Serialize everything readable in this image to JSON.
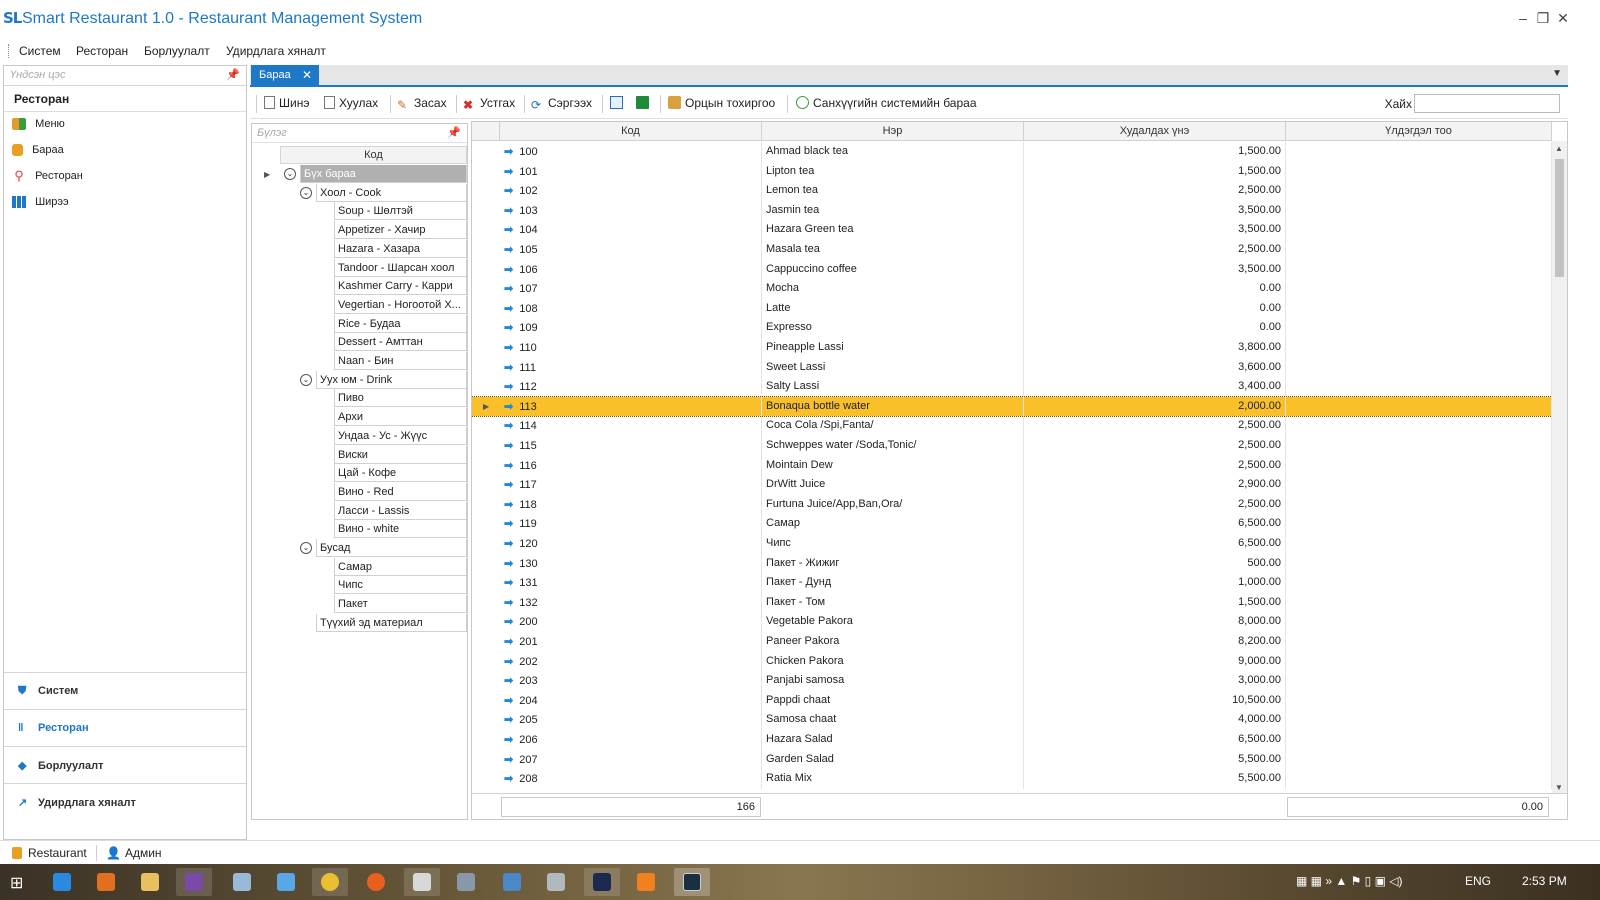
{
  "app": {
    "logo": "SL",
    "title": "Smart Restaurant 1.0 - Restaurant Management System"
  },
  "menu": [
    "Систем",
    "Ресторан",
    "Борлуулалт",
    "Удирдлага хяналт"
  ],
  "left_panel": {
    "header_placeholder": "Үндсэн цэс",
    "section_title": "Ресторан",
    "items": [
      {
        "label": "Меню",
        "icon": "menu-grid-icon"
      },
      {
        "label": "Бараа",
        "icon": "product-icon"
      },
      {
        "label": "Ресторан",
        "icon": "location-pin-icon"
      },
      {
        "label": "Ширээ",
        "icon": "table-grid-icon"
      }
    ],
    "nav": [
      {
        "label": "Систем",
        "icon": "shield-icon",
        "active": false
      },
      {
        "label": "Ресторан",
        "icon": "fork-knife-icon",
        "active": true
      },
      {
        "label": "Борлуулалт",
        "icon": "tag-icon",
        "active": false
      },
      {
        "label": "Удирдлага хяналт",
        "icon": "chart-icon",
        "active": false
      }
    ]
  },
  "tab": {
    "label": "Бараа"
  },
  "toolbar": {
    "new": "Шинэ",
    "copy": "Хуулах",
    "edit": "Засах",
    "delete": "Устгах",
    "refresh": "Сэргээх",
    "settings": "Орцын тохиргоо",
    "finance": "Санхүүгийн системийн бараа",
    "search_label": "Хайх"
  },
  "group_panel": {
    "header_placeholder": "Бүлэг",
    "column": "Код",
    "tree": [
      {
        "label": "Бүх бараа",
        "level": 0,
        "expander": true,
        "selected": true
      },
      {
        "label": "Хоол - Cook",
        "level": 1,
        "expander": true
      },
      {
        "label": "Soup - Шөлтэй",
        "level": 2
      },
      {
        "label": "Appetizer - Хачир",
        "level": 2
      },
      {
        "label": "Hazara - Хазара",
        "level": 2
      },
      {
        "label": "Tandoor - Шарсан хоол",
        "level": 2
      },
      {
        "label": "Kashmer Carry - Карри",
        "level": 2
      },
      {
        "label": "Vegertian - Ногоотой Х...",
        "level": 2
      },
      {
        "label": "Rice - Будаа",
        "level": 2
      },
      {
        "label": "Dessert - Амттан",
        "level": 2
      },
      {
        "label": "Naan - Бин",
        "level": 2
      },
      {
        "label": "Уух юм - Drink",
        "level": 1,
        "expander": true
      },
      {
        "label": "Пиво",
        "level": 2
      },
      {
        "label": "Архи",
        "level": 2
      },
      {
        "label": "Ундаа - Ус - Жүүс",
        "level": 2
      },
      {
        "label": "Виски",
        "level": 2
      },
      {
        "label": "Цай - Кофе",
        "level": 2
      },
      {
        "label": "Вино - Red",
        "level": 2
      },
      {
        "label": "Ласси - Lassis",
        "level": 2
      },
      {
        "label": "Вино - white",
        "level": 2
      },
      {
        "label": "Бусад",
        "level": 1,
        "expander": true
      },
      {
        "label": "Самар",
        "level": 2
      },
      {
        "label": "Чипс",
        "level": 2
      },
      {
        "label": "Пакет",
        "level": 2
      },
      {
        "label": "Түүхий эд материал",
        "level": 1
      }
    ]
  },
  "grid": {
    "columns": [
      "Код",
      "Нэр",
      "Худалдах үнэ",
      "Үлдэгдэл тоо"
    ],
    "selected_code": "113",
    "rows": [
      {
        "code": "100",
        "name": "Ahmad black tea",
        "price": "1,500.00"
      },
      {
        "code": "101",
        "name": "Lipton tea",
        "price": "1,500.00"
      },
      {
        "code": "102",
        "name": "Lemon tea",
        "price": "2,500.00"
      },
      {
        "code": "103",
        "name": "Jasmin tea",
        "price": "3,500.00"
      },
      {
        "code": "104",
        "name": "Hazara Green tea",
        "price": "3,500.00"
      },
      {
        "code": "105",
        "name": "Masala tea",
        "price": "2,500.00"
      },
      {
        "code": "106",
        "name": "Cappuccino coffee",
        "price": "3,500.00"
      },
      {
        "code": "107",
        "name": "Mocha",
        "price": "0.00"
      },
      {
        "code": "108",
        "name": "Latte",
        "price": "0.00"
      },
      {
        "code": "109",
        "name": "Expresso",
        "price": "0.00"
      },
      {
        "code": "110",
        "name": "Pineapple Lassi",
        "price": "3,800.00"
      },
      {
        "code": "111",
        "name": "Sweet Lassi",
        "price": "3,600.00"
      },
      {
        "code": "112",
        "name": "Salty Lassi",
        "price": "3,400.00"
      },
      {
        "code": "113",
        "name": "Bonaqua bottle water",
        "price": "2,000.00"
      },
      {
        "code": "114",
        "name": "Coca Cola /Spi,Fanta/",
        "price": "2,500.00"
      },
      {
        "code": "115",
        "name": "Schweppes water /Soda,Tonic/",
        "price": "2,500.00"
      },
      {
        "code": "116",
        "name": "Mointain Dew",
        "price": "2,500.00"
      },
      {
        "code": "117",
        "name": "DrWitt Juice",
        "price": "2,900.00"
      },
      {
        "code": "118",
        "name": "Furtuna Juice/App,Ban,Ora/",
        "price": "2,500.00"
      },
      {
        "code": "119",
        "name": "Самар",
        "price": "6,500.00"
      },
      {
        "code": "120",
        "name": "Чипс",
        "price": "6,500.00"
      },
      {
        "code": "130",
        "name": "Пакет - Жижиг",
        "price": "500.00"
      },
      {
        "code": "131",
        "name": "Пакет - Дунд",
        "price": "1,000.00"
      },
      {
        "code": "132",
        "name": "Пакет - Том",
        "price": "1,500.00"
      },
      {
        "code": "200",
        "name": "Vegetable Pakora",
        "price": "8,000.00"
      },
      {
        "code": "201",
        "name": "Paneer Pakora",
        "price": "8,200.00"
      },
      {
        "code": "202",
        "name": "Chicken Pakora",
        "price": "9,000.00"
      },
      {
        "code": "203",
        "name": "Panjabi samosa",
        "price": "3,000.00"
      },
      {
        "code": "204",
        "name": "Pappdi chaat",
        "price": "10,500.00"
      },
      {
        "code": "205",
        "name": "Samosa chaat",
        "price": "4,000.00"
      },
      {
        "code": "206",
        "name": "Hazara Salad",
        "price": "6,500.00"
      },
      {
        "code": "207",
        "name": "Garden Salad",
        "price": "5,500.00"
      },
      {
        "code": "208",
        "name": "Ratia Mix",
        "price": "5,500.00"
      }
    ],
    "footer_count": "166",
    "footer_total": "0.00"
  },
  "status_bar": {
    "restaurant": "Restaurant",
    "user": "Админ"
  },
  "taskbar": {
    "lang": "ENG",
    "time": "2:53 PM"
  },
  "colors": {
    "accent": "#1e78c8",
    "selection": "#f9c02a",
    "arrow": "#1e8ad8"
  }
}
